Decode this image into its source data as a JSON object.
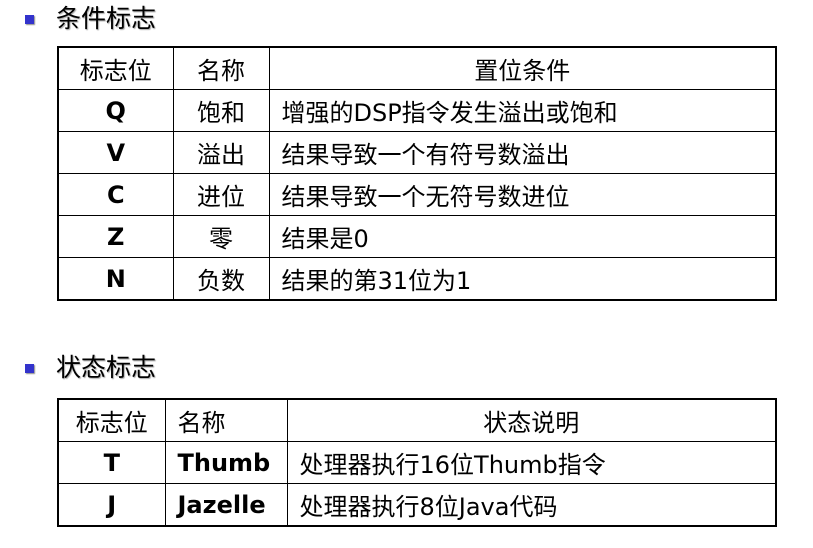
{
  "bullet_color": "#3333cc",
  "condition_flags": {
    "heading": "条件标志",
    "headers": {
      "flag": "标志位",
      "name": "名称",
      "condition": "置位条件"
    },
    "rows": [
      {
        "flag": "Q",
        "name": "饱和",
        "condition": "增强的DSP指令发生溢出或饱和"
      },
      {
        "flag": "V",
        "name": "溢出",
        "condition": "结果导致一个有符号数溢出"
      },
      {
        "flag": "C",
        "name": "进位",
        "condition": "结果导致一个无符号数进位"
      },
      {
        "flag": "Z",
        "name": "零",
        "condition": "结果是0"
      },
      {
        "flag": "N",
        "name": "负数",
        "condition": "结果的第31位为1"
      }
    ]
  },
  "state_flags": {
    "heading": "状态标志",
    "headers": {
      "flag": "标志位",
      "name": "名称",
      "description": "状态说明"
    },
    "rows": [
      {
        "flag": "T",
        "name": "Thumb",
        "description": "处理器执行16位Thumb指令"
      },
      {
        "flag": "J",
        "name": "Jazelle",
        "description": "处理器执行8位Java代码"
      }
    ]
  }
}
